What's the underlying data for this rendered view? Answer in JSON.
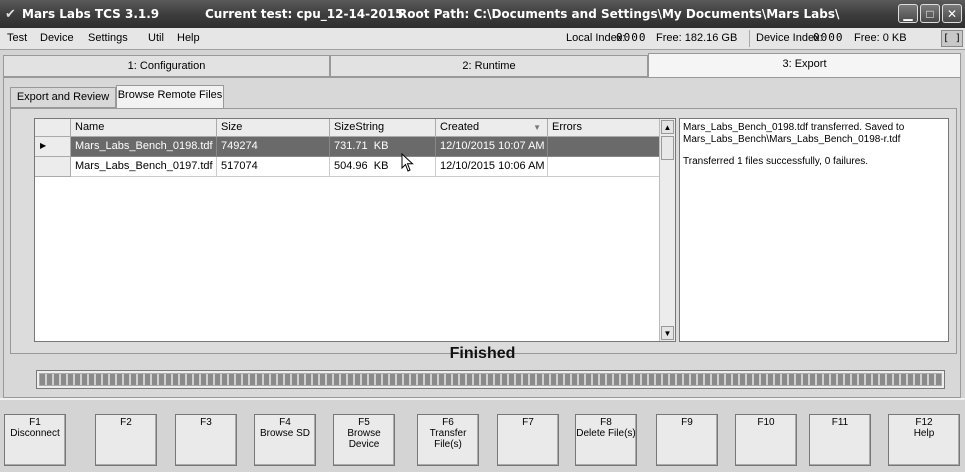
{
  "window": {
    "app_title": "Mars Labs TCS  3.1.9",
    "current_test": "Current test: cpu_12-14-2015",
    "root_path": "Root Path: C:\\Documents and Settings\\My Documents\\Mars Labs\\",
    "minimize_icon": "minimize-icon",
    "maximize_icon": "maximize-icon",
    "close_icon": "close-icon"
  },
  "menu": {
    "items": [
      "Test",
      "Device",
      "Settings",
      "Util",
      "Help"
    ]
  },
  "status": {
    "local_index_label": "Local Index:",
    "local_index_value": "0000",
    "local_free": "Free: 182.16 GB",
    "device_index_label": "Device Index:",
    "device_index_value": "0000",
    "device_free": "Free: 0 KB",
    "bracket": "[ ]"
  },
  "main_tabs": [
    "1: Configuration",
    "2: Runtime",
    "3: Export"
  ],
  "sub_tabs": [
    "Export and Review",
    "Browse Remote Files"
  ],
  "grid": {
    "columns": [
      "Name",
      "Size",
      "SizeString",
      "Created",
      "Errors"
    ],
    "sort_icon": "sort-descending-icon",
    "rows": [
      {
        "name": "Mars_Labs_Bench_0198.tdf",
        "size": "749274",
        "size_string": "731.71  KB",
        "created": "12/10/2015 10:07 AM",
        "errors": "",
        "selected": true
      },
      {
        "name": "Mars_Labs_Bench_0197.tdf",
        "size": "517074",
        "size_string": "504.96  KB",
        "created": "12/10/2015 10:06 AM",
        "errors": "",
        "selected": false
      }
    ]
  },
  "log": {
    "line1": "Mars_Labs_Bench_0198.tdf transferred.  Saved to",
    "line2": "Mars_Labs_Bench\\Mars_Labs_Bench_0198-r.tdf",
    "line3": "Transferred 1 files successfully, 0 failures."
  },
  "status_text": "Finished",
  "progress": {
    "value": 1.0
  },
  "fkeys": [
    {
      "key": "F1",
      "label": "Disconnect"
    },
    {
      "key": "F2",
      "label": ""
    },
    {
      "key": "F3",
      "label": ""
    },
    {
      "key": "F4",
      "label": "Browse SD"
    },
    {
      "key": "F5",
      "label": "Browse Device"
    },
    {
      "key": "F6",
      "label": "Transfer File(s)"
    },
    {
      "key": "F7",
      "label": ""
    },
    {
      "key": "F8",
      "label": "Delete File(s)"
    },
    {
      "key": "F9",
      "label": ""
    },
    {
      "key": "F10",
      "label": ""
    },
    {
      "key": "F11",
      "label": ""
    },
    {
      "key": "F12",
      "label": "Help"
    }
  ],
  "colors": {
    "selected_row": "#6a6a6a",
    "titlebar": "#3e3e3e"
  }
}
